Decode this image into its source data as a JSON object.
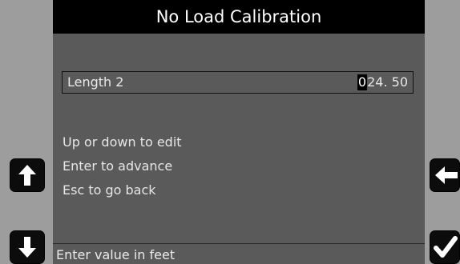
{
  "title": "No Load Calibration",
  "field": {
    "label": "Length 2",
    "cursor_digit": "0",
    "value_rest": "24. 50"
  },
  "instructions": [
    "Up or down to edit",
    "Enter to advance",
    "Esc to go back"
  ],
  "status": "Enter value in feet",
  "buttons": {
    "up_icon": "arrow-up-icon",
    "down_icon": "arrow-down-icon",
    "back_icon": "arrow-left-icon",
    "enter_icon": "checkmark-icon"
  },
  "colors": {
    "background": "#9a9a9a",
    "screen": "#5a5a5a",
    "title_bar": "#000000",
    "text": "#e8e8e8"
  }
}
